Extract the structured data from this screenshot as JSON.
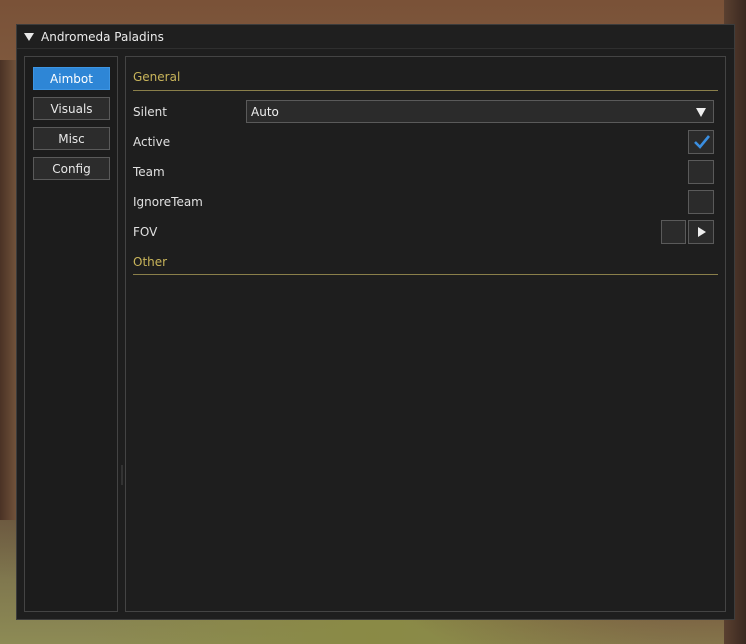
{
  "window": {
    "title": "Andromeda Paladins"
  },
  "sidebar": {
    "tabs": [
      {
        "label": "Aimbot",
        "active": true
      },
      {
        "label": "Visuals",
        "active": false
      },
      {
        "label": "Misc",
        "active": false
      },
      {
        "label": "Config",
        "active": false
      }
    ]
  },
  "content": {
    "general_title": "General",
    "other_title": "Other",
    "silent": {
      "label": "Silent",
      "value": "Auto"
    },
    "active": {
      "label": "Active",
      "checked": true
    },
    "team": {
      "label": "Team",
      "checked": false
    },
    "ignore_team": {
      "label": "IgnoreTeam",
      "checked": false
    },
    "fov": {
      "label": "FOV"
    }
  },
  "colors": {
    "accent": "#2e86d6",
    "section": "#c8b45a",
    "check": "#3a8ee0"
  }
}
